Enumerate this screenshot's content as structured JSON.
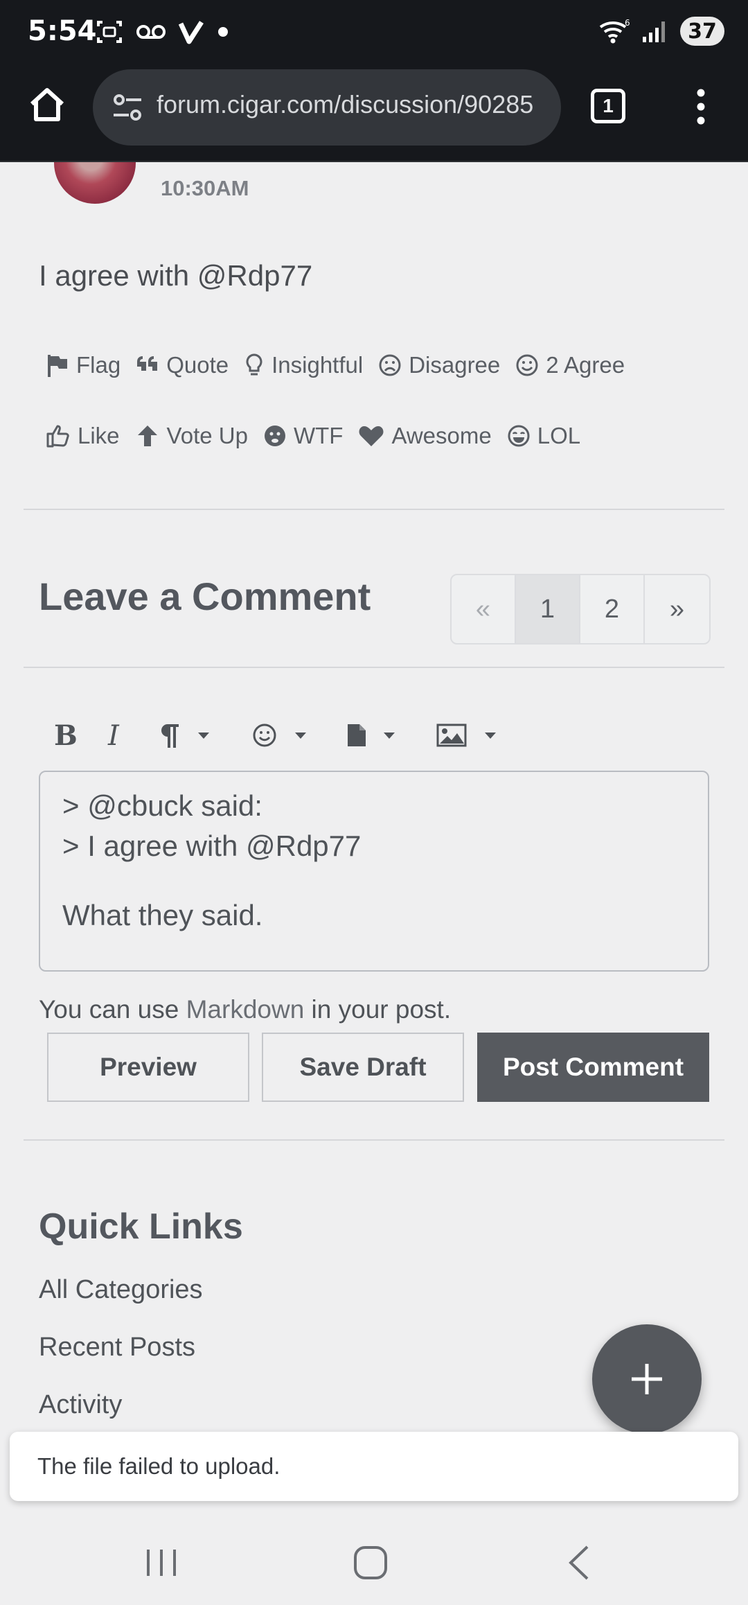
{
  "status_bar": {
    "time": "5:54",
    "battery": "37",
    "signal_label": "6"
  },
  "browser": {
    "url": "forum.cigar.com/discussion/90285",
    "tab_count": "1"
  },
  "post": {
    "time": "10:30AM",
    "body": "I agree with @Rdp77",
    "reactions_row1": [
      {
        "icon": "flag-icon",
        "label": "Flag"
      },
      {
        "icon": "quote-icon",
        "label": "Quote"
      },
      {
        "icon": "lightbulb-icon",
        "label": "Insightful"
      },
      {
        "icon": "frown-icon",
        "label": "Disagree"
      },
      {
        "icon": "smile-icon",
        "label": "2 Agree"
      }
    ],
    "reactions_row2": [
      {
        "icon": "thumbs-up-icon",
        "label": "Like"
      },
      {
        "icon": "arrow-up-icon",
        "label": "Vote Up"
      },
      {
        "icon": "wtf-face-icon",
        "label": "WTF"
      },
      {
        "icon": "heart-icon",
        "label": "Awesome"
      },
      {
        "icon": "laugh-icon",
        "label": "LOL"
      }
    ]
  },
  "comment": {
    "title": "Leave a Comment",
    "pager": [
      "«",
      "1",
      "2",
      "»"
    ],
    "editor_lines": [
      "> @cbuck said:",
      "> I agree with @Rdp77",
      "",
      "What they said."
    ],
    "markdown_note_prefix": "You can use ",
    "markdown_link": "Markdown",
    "markdown_note_suffix": " in your post.",
    "preview_label": "Preview",
    "save_draft_label": "Save Draft",
    "post_label": "Post Comment"
  },
  "quick_links": {
    "title": "Quick Links",
    "items": [
      "All Categories",
      "Recent Posts",
      "Activity"
    ]
  },
  "toast": {
    "message": "The file failed to upload."
  }
}
